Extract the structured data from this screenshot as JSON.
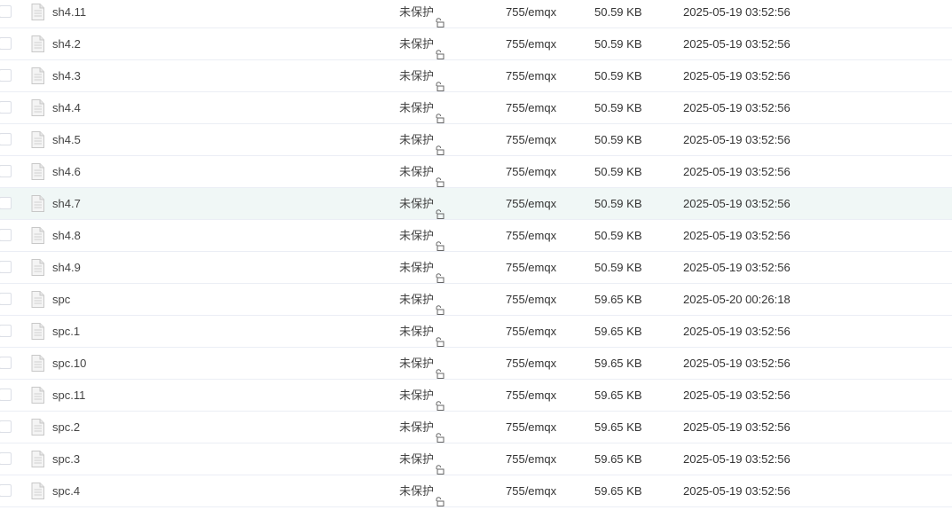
{
  "colors": {
    "row_border": "#ebeef5",
    "hover_bg": "#f0f7f6",
    "text": "#444444",
    "icon": "#c8c8c8"
  },
  "icons": {
    "file": "file-icon",
    "lock": "unlock-icon",
    "checkbox": "checkbox"
  },
  "files": [
    {
      "name": "sh4.11",
      "protection": "未保护",
      "perm": "755/emqx",
      "size": "50.59 KB",
      "modified": "2025-05-19 03:52:56"
    },
    {
      "name": "sh4.2",
      "protection": "未保护",
      "perm": "755/emqx",
      "size": "50.59 KB",
      "modified": "2025-05-19 03:52:56"
    },
    {
      "name": "sh4.3",
      "protection": "未保护",
      "perm": "755/emqx",
      "size": "50.59 KB",
      "modified": "2025-05-19 03:52:56"
    },
    {
      "name": "sh4.4",
      "protection": "未保护",
      "perm": "755/emqx",
      "size": "50.59 KB",
      "modified": "2025-05-19 03:52:56"
    },
    {
      "name": "sh4.5",
      "protection": "未保护",
      "perm": "755/emqx",
      "size": "50.59 KB",
      "modified": "2025-05-19 03:52:56"
    },
    {
      "name": "sh4.6",
      "protection": "未保护",
      "perm": "755/emqx",
      "size": "50.59 KB",
      "modified": "2025-05-19 03:52:56"
    },
    {
      "name": "sh4.7",
      "protection": "未保护",
      "perm": "755/emqx",
      "size": "50.59 KB",
      "modified": "2025-05-19 03:52:56",
      "hovered": true
    },
    {
      "name": "sh4.8",
      "protection": "未保护",
      "perm": "755/emqx",
      "size": "50.59 KB",
      "modified": "2025-05-19 03:52:56"
    },
    {
      "name": "sh4.9",
      "protection": "未保护",
      "perm": "755/emqx",
      "size": "50.59 KB",
      "modified": "2025-05-19 03:52:56"
    },
    {
      "name": "spc",
      "protection": "未保护",
      "perm": "755/emqx",
      "size": "59.65 KB",
      "modified": "2025-05-20 00:26:18"
    },
    {
      "name": "spc.1",
      "protection": "未保护",
      "perm": "755/emqx",
      "size": "59.65 KB",
      "modified": "2025-05-19 03:52:56"
    },
    {
      "name": "spc.10",
      "protection": "未保护",
      "perm": "755/emqx",
      "size": "59.65 KB",
      "modified": "2025-05-19 03:52:56"
    },
    {
      "name": "spc.11",
      "protection": "未保护",
      "perm": "755/emqx",
      "size": "59.65 KB",
      "modified": "2025-05-19 03:52:56"
    },
    {
      "name": "spc.2",
      "protection": "未保护",
      "perm": "755/emqx",
      "size": "59.65 KB",
      "modified": "2025-05-19 03:52:56"
    },
    {
      "name": "spc.3",
      "protection": "未保护",
      "perm": "755/emqx",
      "size": "59.65 KB",
      "modified": "2025-05-19 03:52:56"
    },
    {
      "name": "spc.4",
      "protection": "未保护",
      "perm": "755/emqx",
      "size": "59.65 KB",
      "modified": "2025-05-19 03:52:56"
    }
  ]
}
